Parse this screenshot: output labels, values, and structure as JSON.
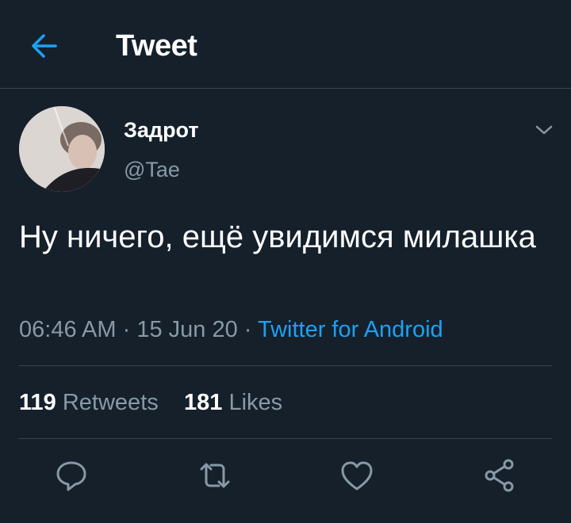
{
  "header": {
    "title": "Tweet",
    "back_icon": "arrow-left-icon"
  },
  "author": {
    "name": "Задрот",
    "handle": "@Tae"
  },
  "tweet": {
    "text": "Ну ничего, ещё увидимся милашка",
    "time": "06:46 AM",
    "sep1": " · ",
    "date": "15 Jun 20",
    "sep2": " · ",
    "source": "Twitter for Android"
  },
  "stats": {
    "retweets_count": "119",
    "retweets_label": "Retweets",
    "likes_count": "181",
    "likes_label": "Likes"
  },
  "actions": [
    "reply-icon",
    "retweet-icon",
    "like-icon",
    "share-icon"
  ],
  "colors": {
    "background": "#15202b",
    "accent": "#1da1f2",
    "secondary_text": "#8899a6",
    "divider": "#38444d"
  }
}
